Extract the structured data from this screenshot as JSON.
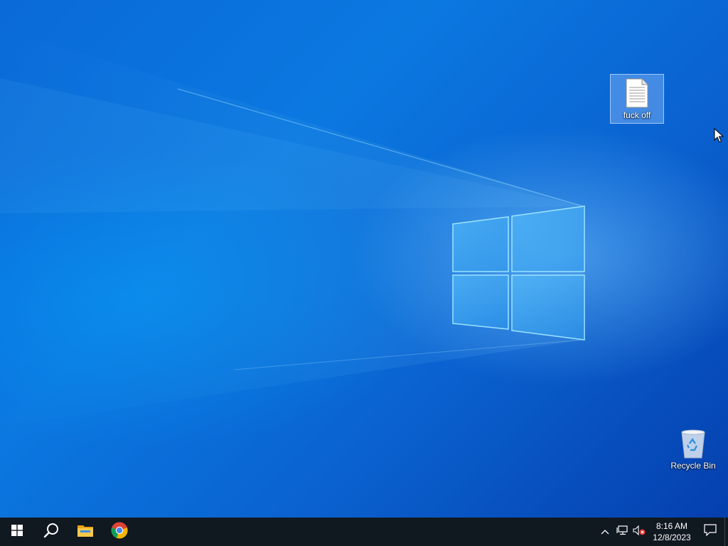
{
  "desktop": {
    "icons": [
      {
        "label": "fuck off",
        "icon": "text-document-icon",
        "selected": true
      },
      {
        "label": "Recycle Bin",
        "icon": "recycle-bin-icon",
        "selected": false
      }
    ]
  },
  "taskbar": {
    "start_icon": "windows-start-icon",
    "search_icon": "search-icon",
    "pinned": [
      {
        "name": "File Explorer",
        "icon": "file-explorer-icon"
      },
      {
        "name": "Google Chrome",
        "icon": "chrome-icon"
      }
    ],
    "tray": {
      "chevron_icon": "chevron-up-icon",
      "network_icon": "network-icon",
      "volume_icon": "volume-muted-icon"
    },
    "clock": {
      "time": "8:16 AM",
      "date": "12/8/2023"
    },
    "notification_icon": "action-center-icon"
  },
  "colors": {
    "wallpaper_primary": "#0a6ad8",
    "wallpaper_dark": "#053fae",
    "taskbar": "#101820",
    "logo_glow": "#7fd4ff"
  }
}
